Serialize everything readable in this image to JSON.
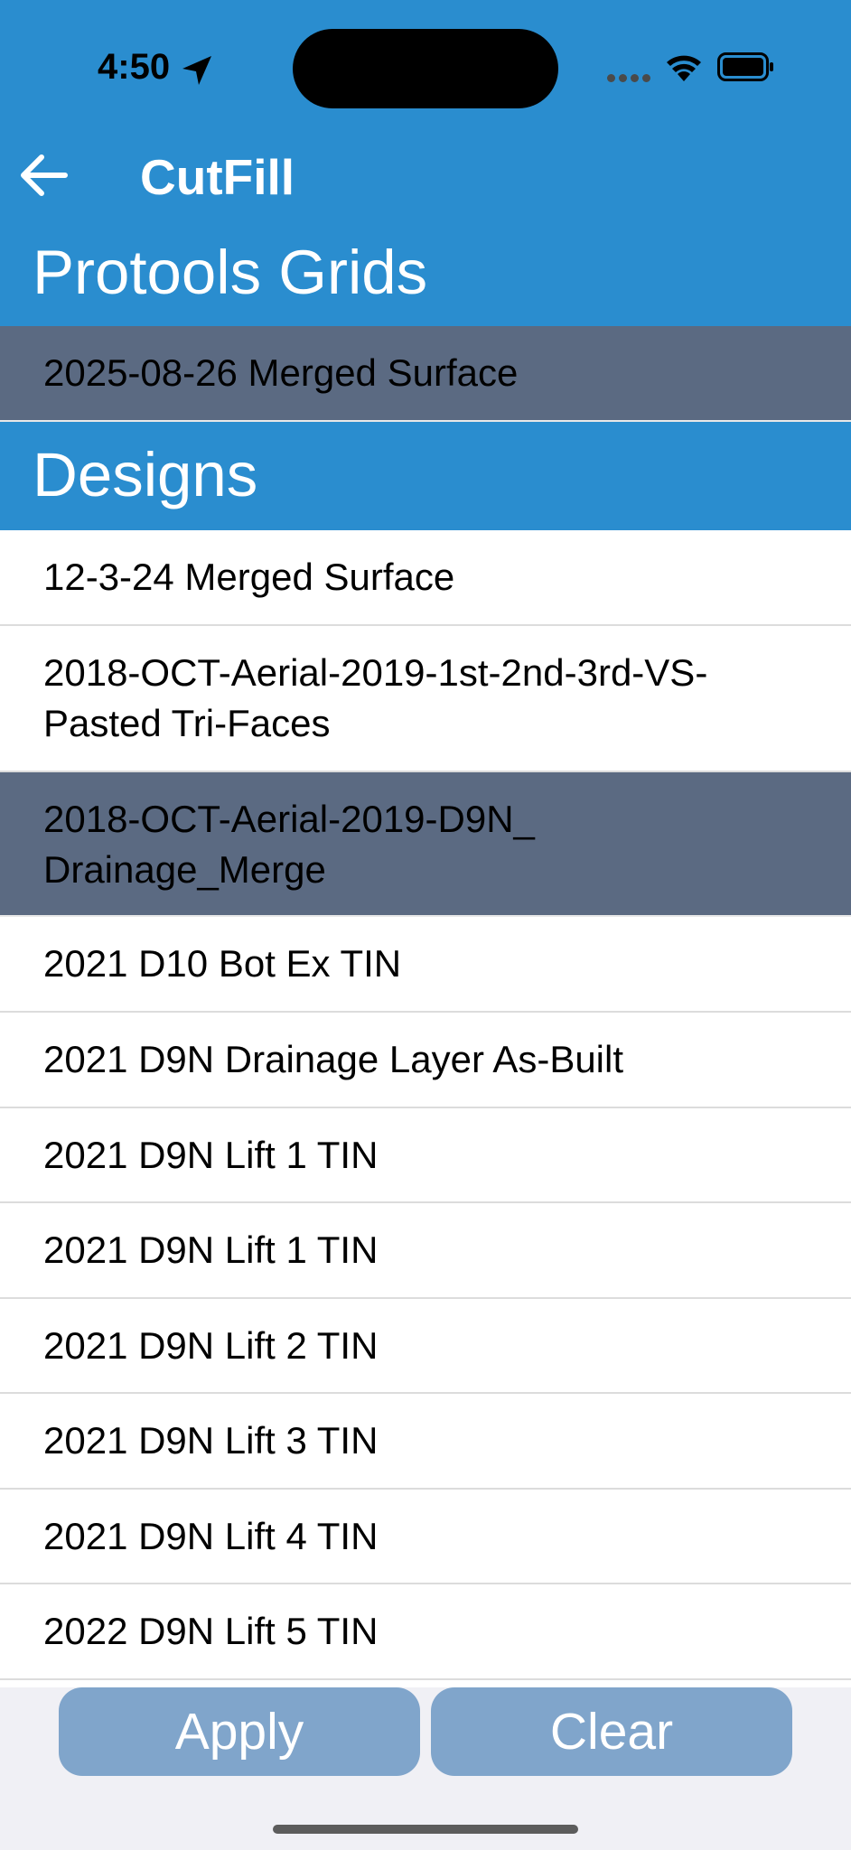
{
  "status_bar": {
    "time": "4:50"
  },
  "nav": {
    "title": "CutFill"
  },
  "sections": {
    "grids_title": "Protools Grids",
    "designs_title": "Designs"
  },
  "grids": [
    {
      "label": "2025-08-26 Merged Surface",
      "selected": true
    }
  ],
  "designs": [
    {
      "label": "12-3-24 Merged Surface",
      "selected": false
    },
    {
      "label": "2018-OCT-Aerial-2019-1st-2nd-3rd-VS-Pasted Tri-Faces",
      "selected": false
    },
    {
      "label": "2018-OCT-Aerial-2019-D9N_Drainage_Merge",
      "selected": true
    },
    {
      "label": "2021 D10 Bot Ex TIN",
      "selected": false
    },
    {
      "label": "2021 D9N Drainage Layer As-Built",
      "selected": false
    },
    {
      "label": "2021 D9N Lift 1 TIN",
      "selected": false
    },
    {
      "label": "2021 D9N Lift 1 TIN",
      "selected": false
    },
    {
      "label": "2021 D9N Lift 2 TIN",
      "selected": false
    },
    {
      "label": "2021 D9N Lift 3 TIN",
      "selected": false
    },
    {
      "label": "2021 D9N Lift 4 TIN",
      "selected": false
    },
    {
      "label": "2022 D9N Lift 5 TIN",
      "selected": false
    }
  ],
  "footer": {
    "apply_label": "Apply",
    "clear_label": "Clear"
  },
  "colors": {
    "header_blue": "#2a8dcf",
    "selected_row": "#5b6a82",
    "button": "#80a5cb"
  }
}
